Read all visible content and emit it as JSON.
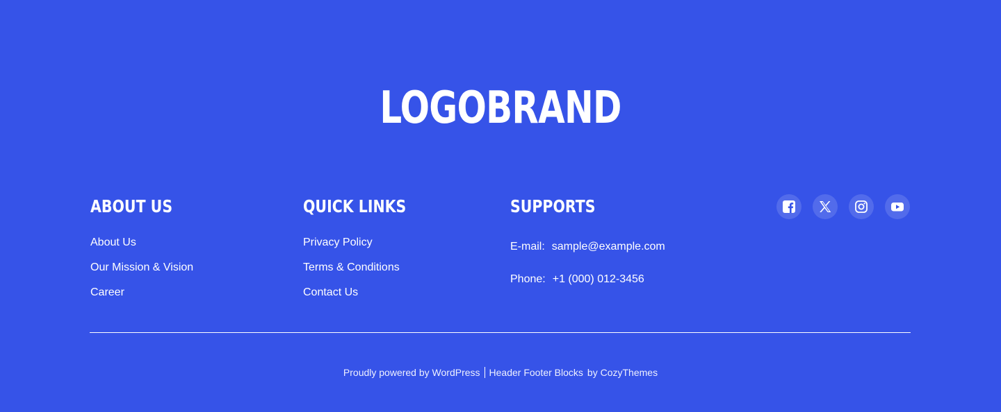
{
  "brand": {
    "logo_text": "LOGOBRAND"
  },
  "about": {
    "heading": "ABOUT US",
    "links": [
      "About Us",
      "Our Mission & Vision",
      "Career"
    ]
  },
  "quick_links": {
    "heading": "QUICK LINKS",
    "links": [
      "Privacy Policy",
      "Terms & Conditions",
      "Contact Us"
    ]
  },
  "supports": {
    "heading": "SUPPORTS",
    "email_label": "E-mail:",
    "email_value": "sample@example.com",
    "phone_label": "Phone:",
    "phone_value": "+1 (000) 012-3456"
  },
  "social": {
    "icons": [
      "facebook-icon",
      "x-twitter-icon",
      "instagram-icon",
      "youtube-icon"
    ]
  },
  "credits": {
    "powered_by": "Proudly powered by WordPress",
    "theme_name": "Header Footer Blocks",
    "by_text": "by CozyThemes"
  },
  "colors": {
    "background": "#3653e8",
    "text": "#ffffff"
  }
}
